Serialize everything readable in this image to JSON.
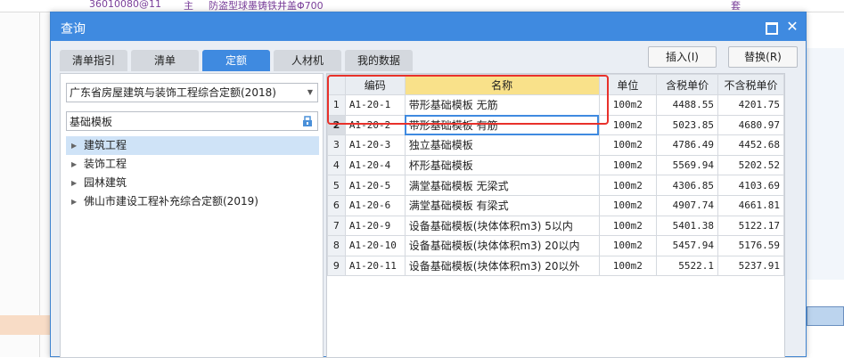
{
  "background": {
    "row_code": "36010080@11",
    "row_kind": "主",
    "row_name": "防盗型球墨铸铁井盖Φ700",
    "row_unit": "套"
  },
  "dialog": {
    "title": "查询",
    "tabs": [
      "清单指引",
      "清单",
      "定额",
      "人材机",
      "我的数据"
    ],
    "active_tab": "定额",
    "insert_label": "插入(I)",
    "replace_label": "替换(R)",
    "quota_library": "广东省房屋建筑与装饰工程综合定额(2018)",
    "search_value": "基础模板",
    "tree": [
      {
        "label": "建筑工程",
        "selected": true
      },
      {
        "label": "装饰工程",
        "selected": false
      },
      {
        "label": "园林建筑",
        "selected": false
      },
      {
        "label": "佛山市建设工程补充综合定额(2019)",
        "selected": false
      }
    ],
    "grid": {
      "columns": [
        "",
        "编码",
        "名称",
        "单位",
        "含税单价",
        "不含税单价"
      ],
      "rows": [
        {
          "no": "1",
          "code": "A1-20-1",
          "name": "带形基础模板 无筋",
          "unit": "100m2",
          "tax_price": "4488.55",
          "notax_price": "4201.75"
        },
        {
          "no": "2",
          "code": "A1-20-2",
          "name": "带形基础模板 有筋",
          "unit": "100m2",
          "tax_price": "5023.85",
          "notax_price": "4680.97"
        },
        {
          "no": "3",
          "code": "A1-20-3",
          "name": "独立基础模板",
          "unit": "100m2",
          "tax_price": "4786.49",
          "notax_price": "4452.68"
        },
        {
          "no": "4",
          "code": "A1-20-4",
          "name": "杯形基础模板",
          "unit": "100m2",
          "tax_price": "5569.94",
          "notax_price": "5202.52"
        },
        {
          "no": "5",
          "code": "A1-20-5",
          "name": "满堂基础模板 无梁式",
          "unit": "100m2",
          "tax_price": "4306.85",
          "notax_price": "4103.69"
        },
        {
          "no": "6",
          "code": "A1-20-6",
          "name": "满堂基础模板 有梁式",
          "unit": "100m2",
          "tax_price": "4907.74",
          "notax_price": "4661.81"
        },
        {
          "no": "7",
          "code": "A1-20-9",
          "name": "设备基础模板(块体体积m3) 5以内",
          "unit": "100m2",
          "tax_price": "5401.38",
          "notax_price": "5122.17"
        },
        {
          "no": "8",
          "code": "A1-20-10",
          "name": "设备基础模板(块体体积m3) 20以内",
          "unit": "100m2",
          "tax_price": "5457.94",
          "notax_price": "5176.59"
        },
        {
          "no": "9",
          "code": "A1-20-11",
          "name": "设备基础模板(块体体积m3) 20以外",
          "unit": "100m2",
          "tax_price": "5522.1",
          "notax_price": "5237.91"
        }
      ]
    },
    "colors": {
      "accent": "#3f8ae0",
      "highlight_box": "#e8312b",
      "selected_header": "#f9e18a"
    }
  }
}
